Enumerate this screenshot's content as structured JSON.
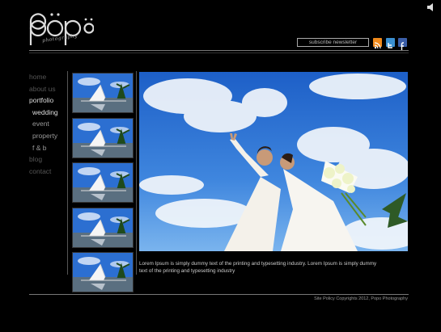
{
  "brand": {
    "logo_text": "pöpö",
    "tagline": "photography"
  },
  "header": {
    "subscribe_label": "subscribe newsletter",
    "sound_icon": "speaker-icon",
    "social": [
      "rss-icon",
      "twitter-icon",
      "facebook-icon"
    ]
  },
  "nav": {
    "items": [
      {
        "label": "home",
        "state": "dim"
      },
      {
        "label": "about us",
        "state": "dim"
      },
      {
        "label": "portfolio",
        "state": "lit"
      },
      {
        "label": "wedding",
        "state": "lit-sub"
      },
      {
        "label": "event",
        "state": "dim-sub"
      },
      {
        "label": "property",
        "state": "dim-sub"
      },
      {
        "label": "f & b",
        "state": "dim-sub"
      },
      {
        "label": "blog",
        "state": "dim"
      },
      {
        "label": "contact",
        "state": "dim"
      }
    ]
  },
  "gallery": {
    "thumbnails": 5,
    "caption": "Lorem Ipsum is simply dummy text of the printing and typesetting industry. Lorem Ipsum is simply dummy text of the printing and typesetting industry"
  },
  "footer": {
    "text": "Site Policy  Copyrights 2012, Popo Photography"
  },
  "colors": {
    "background": "#000000",
    "rss": "#f08a1c",
    "twitter": "#3a8fd0",
    "facebook": "#3b5ea8"
  }
}
